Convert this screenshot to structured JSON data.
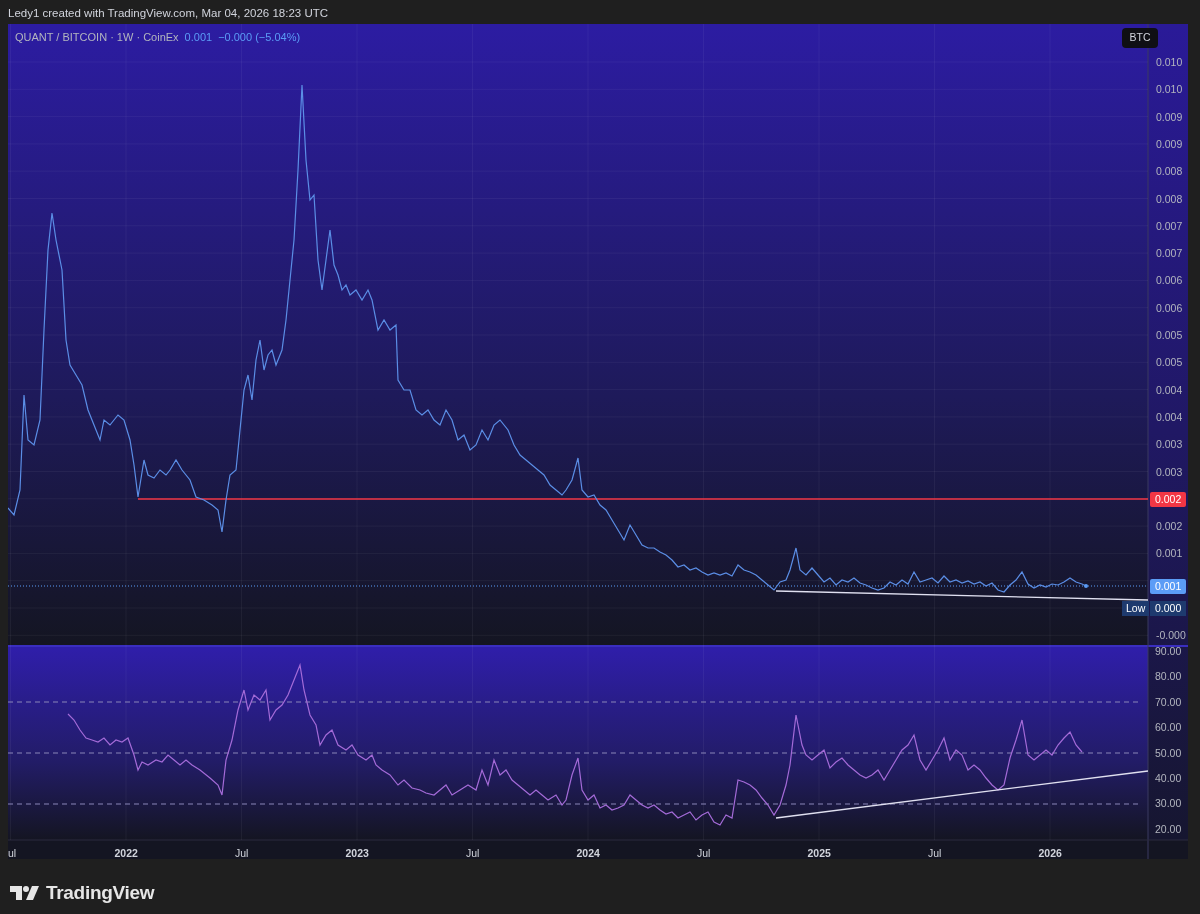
{
  "header": {
    "text": "Ledy1 created with TradingView.com, Mar 04, 2026 18:23 UTC"
  },
  "legend": {
    "symbol": "QUANT / BITCOIN · 1W · CoinEx",
    "price": "0.001",
    "change": "−0.000 (−5.04%)"
  },
  "currency_button": {
    "label": "BTC"
  },
  "price_axis": {
    "ticks": [
      "0.010",
      "0.010",
      "0.009",
      "0.009",
      "0.008",
      "0.008",
      "0.007",
      "0.007",
      "0.006",
      "0.006",
      "0.005",
      "0.005",
      "0.004",
      "0.004",
      "0.003",
      "0.003",
      "0.002",
      "0.001",
      "-0.000"
    ]
  },
  "price_tags": [
    {
      "kind": "level",
      "text": "0.002",
      "color": "#f23645"
    },
    {
      "kind": "last",
      "text": "0.001",
      "color": "#5b9cf6"
    },
    {
      "kind": "low",
      "label": "Low",
      "text": "0.000",
      "color": "#1e3a6e"
    }
  ],
  "rsi_axis": {
    "ticks": [
      "90.00",
      "80.00",
      "70.00",
      "60.00",
      "50.00",
      "40.00",
      "30.00",
      "20.00"
    ]
  },
  "time_axis": {
    "ticks": [
      "ul",
      "2022",
      "Jul",
      "2023",
      "Jul",
      "2024",
      "Jul",
      "2025",
      "Jul",
      "2026"
    ]
  },
  "logo": {
    "text": "TradingView"
  }
}
